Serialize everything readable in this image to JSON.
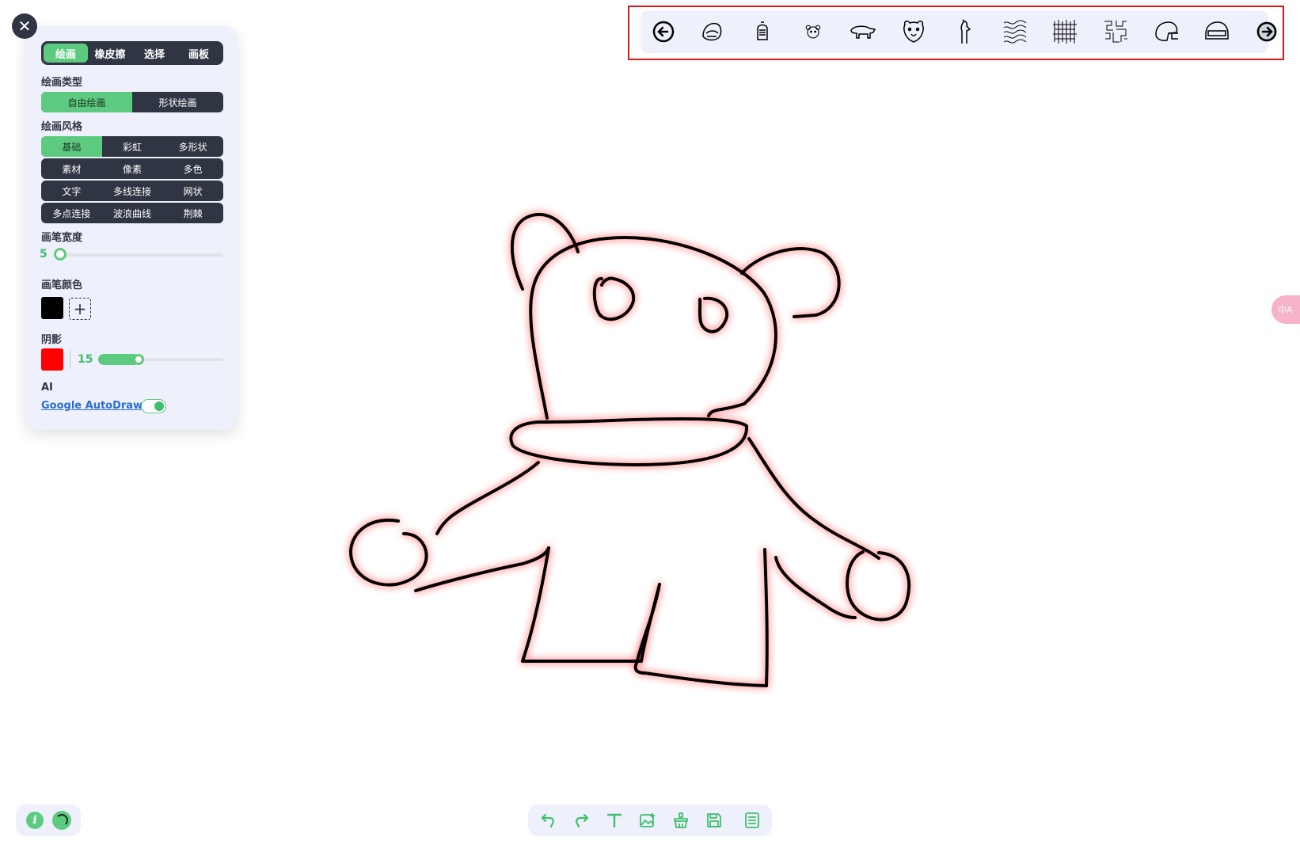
{
  "close_label": "✕",
  "panel": {
    "mode_tabs": [
      "绘画",
      "橡皮擦",
      "选择",
      "画板"
    ],
    "active_mode": "绘画",
    "draw_type": {
      "label": "绘画类型",
      "options": [
        "自由绘画",
        "形状绘画"
      ],
      "active": "自由绘画"
    },
    "draw_style": {
      "label": "绘画风格",
      "rows": [
        [
          "基础",
          "彩虹",
          "多形状"
        ],
        [
          "素材",
          "像素",
          "多色"
        ],
        [
          "文字",
          "多线连接",
          "网状"
        ],
        [
          "多点连接",
          "波浪曲线",
          "荆棘"
        ]
      ],
      "active": "基础"
    },
    "brush_width": {
      "label": "画笔宽度",
      "value": "5",
      "fraction": 0.0
    },
    "brush_color": {
      "label": "画笔颜色",
      "color": "#000000",
      "add_label": "+"
    },
    "shadow": {
      "label": "阴影",
      "color": "#ff0000",
      "value": "15",
      "fraction": 0.33
    },
    "ai": {
      "label": "AI",
      "link": "Google AutoDraw",
      "enabled": true
    }
  },
  "autodraw_suggestions": {
    "prev": "arrow-left-circle-icon",
    "items": [
      "knight-helmet-icon",
      "armor-helmet-icon",
      "bear-face-icon",
      "polar-bear-icon",
      "bear-head-icon",
      "standing-bear-icon",
      "scribble-pattern-icon",
      "hatch-pattern-icon",
      "maze-pattern-icon",
      "football-helmet-icon",
      "racing-helmet-icon"
    ],
    "next": "arrow-right-circle-icon"
  },
  "translate_tab": "中A",
  "bottom_left": {
    "info": "i"
  },
  "toolbar": [
    "undo-icon",
    "redo-icon",
    "text-icon",
    "add-image-icon",
    "clear-icon",
    "save-icon",
    "menu-icon"
  ],
  "colors": {
    "accent": "#5dcb7f",
    "dark": "#2f3542",
    "panel": "#eef1fb",
    "stroke": "#000000",
    "glow": "#ff0000"
  }
}
